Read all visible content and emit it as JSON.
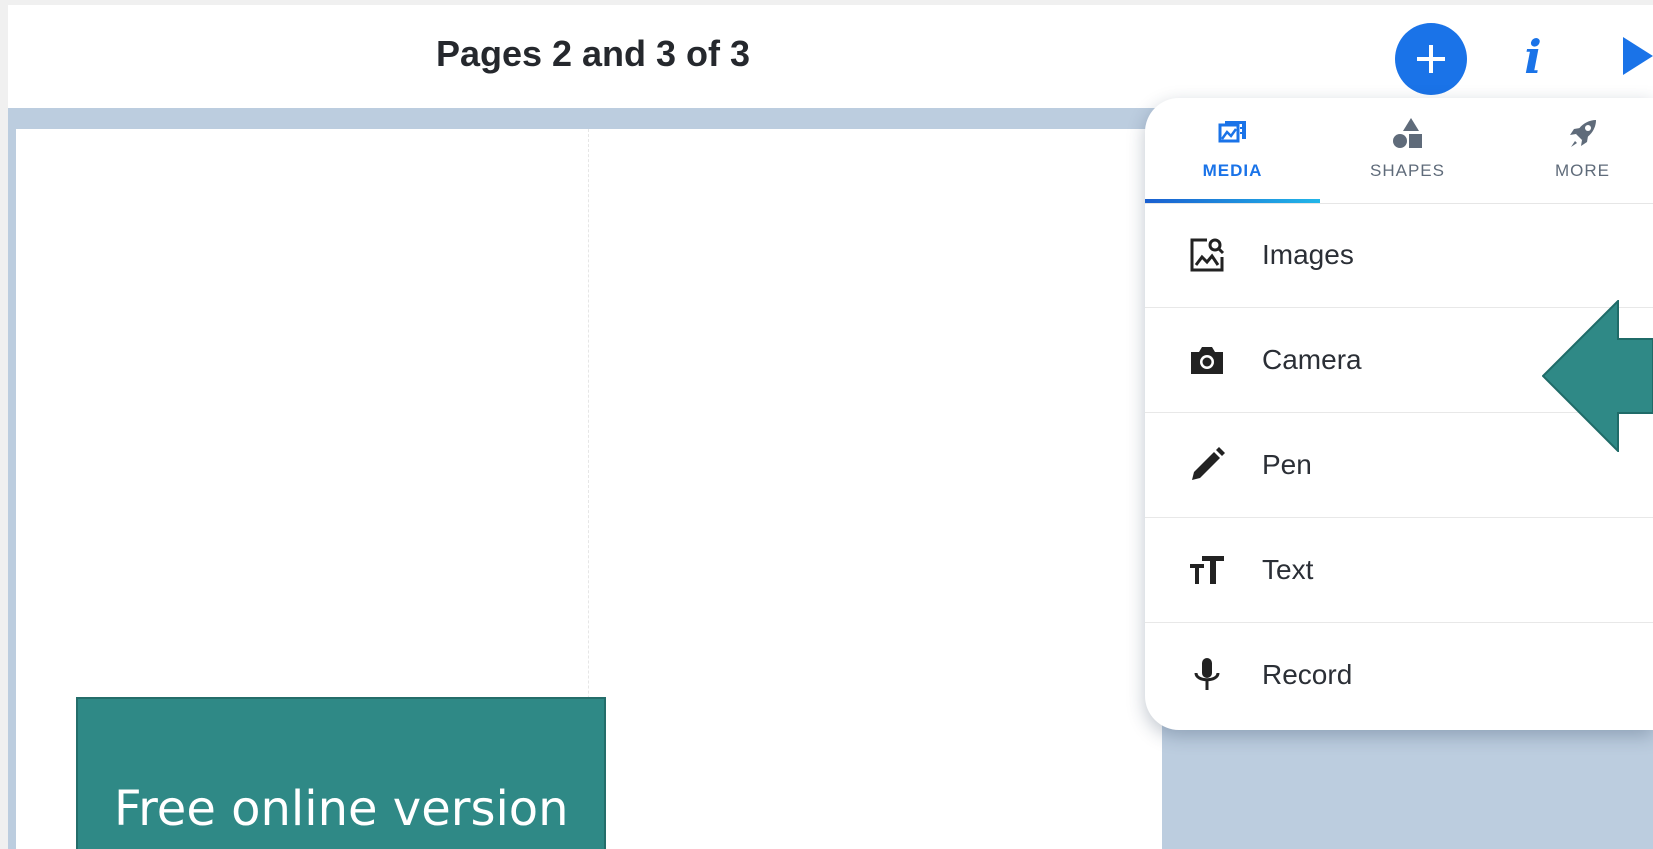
{
  "header": {
    "title": "Pages 2 and 3 of 3"
  },
  "toolbar": {
    "add_icon": "plus-icon",
    "info_icon": "info-icon",
    "info_glyph": "i",
    "play_icon": "play-icon"
  },
  "canvas": {
    "banner_text": "Free online version"
  },
  "insert_menu": {
    "tabs": [
      {
        "label": "MEDIA",
        "icon": "media-icon",
        "active": true
      },
      {
        "label": "SHAPES",
        "icon": "shapes-icon",
        "active": false
      },
      {
        "label": "MORE",
        "icon": "rocket-icon",
        "active": false
      }
    ],
    "items": [
      {
        "label": "Images",
        "icon": "image-search-icon"
      },
      {
        "label": "Camera",
        "icon": "camera-icon"
      },
      {
        "label": "Pen",
        "icon": "pen-icon"
      },
      {
        "label": "Text",
        "icon": "text-size-icon"
      },
      {
        "label": "Record",
        "icon": "microphone-icon"
      }
    ]
  },
  "colors": {
    "accent": "#1a73e8",
    "workspace_bg": "#bccddf",
    "banner_teal": "#2f8986",
    "pointer_arrow": "#2f8986",
    "title_text": "#25282d"
  }
}
